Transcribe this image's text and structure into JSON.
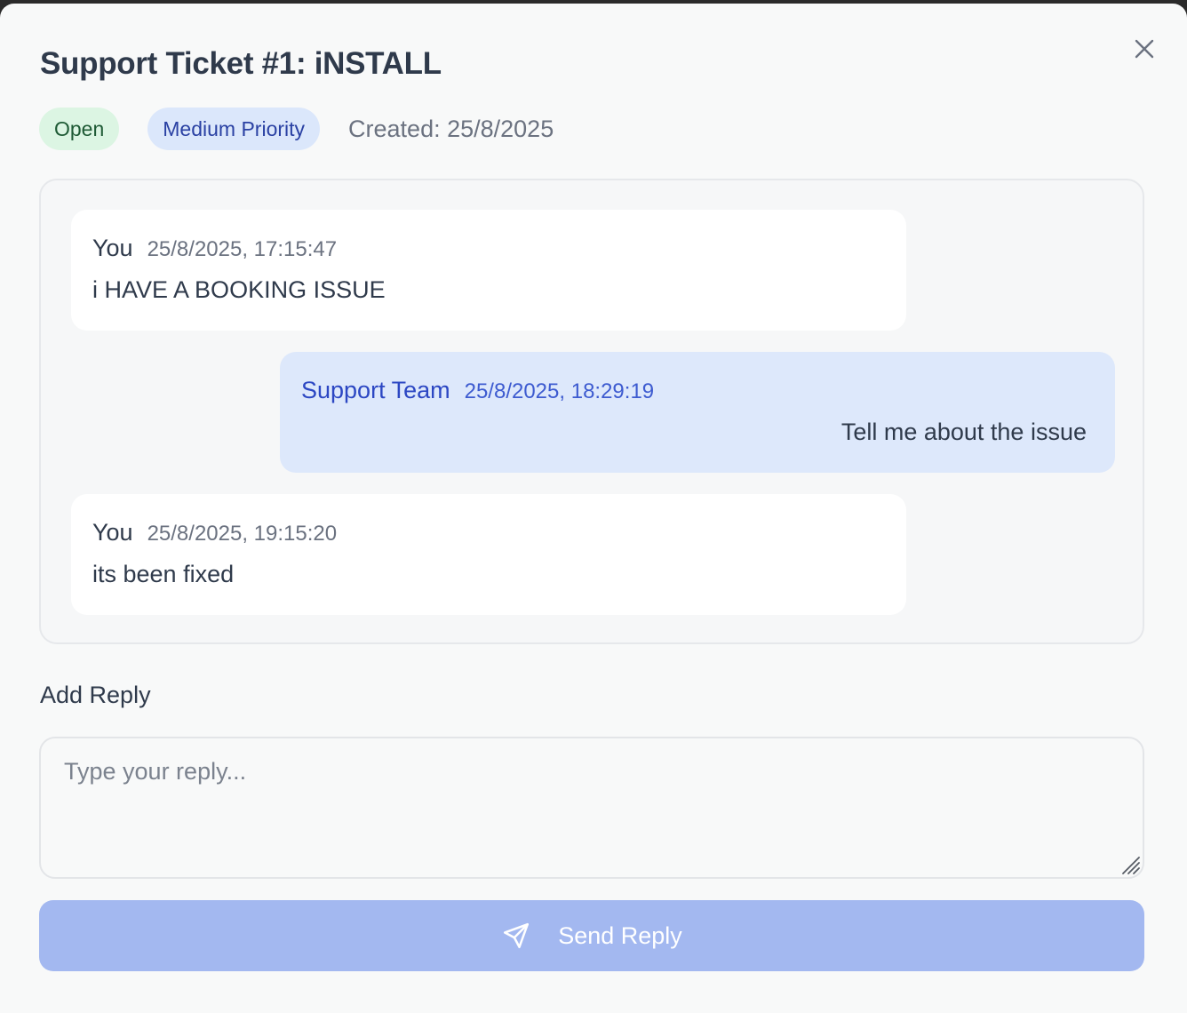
{
  "ticket": {
    "title": "Support Ticket #1: iNSTALL",
    "status_badge": "Open",
    "priority_badge": "Medium Priority",
    "created": "Created: 25/8/2025"
  },
  "messages": [
    {
      "author": "You",
      "timestamp": "25/8/2025, 17:15:47",
      "body": "i HAVE A BOOKING ISSUE"
    },
    {
      "author": "Support Team",
      "timestamp": "25/8/2025, 18:29:19",
      "body": "Tell me about the issue"
    },
    {
      "author": "You",
      "timestamp": "25/8/2025, 19:15:20",
      "body": "its been fixed"
    }
  ],
  "reply": {
    "label": "Add Reply",
    "placeholder": "Type your reply...",
    "value": "",
    "send_label": "Send Reply"
  },
  "icons": {
    "close": "close-icon",
    "send": "send-icon",
    "resize": "resize-handle-icon"
  },
  "colors": {
    "status_open_bg": "#dcf5e3",
    "priority_bg": "#dbe7fb",
    "support_bubble_bg": "#dde8fb",
    "send_button_bg": "#a3b8f0"
  }
}
